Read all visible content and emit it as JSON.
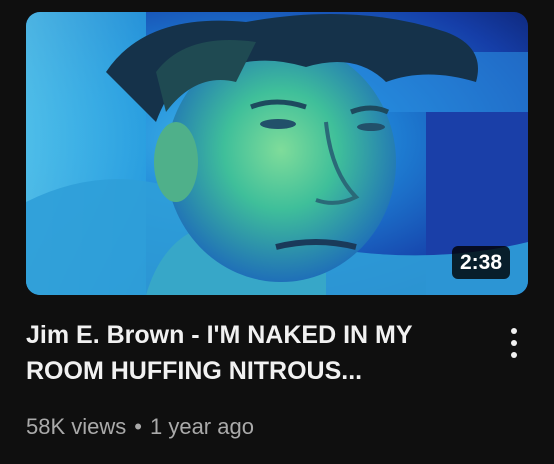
{
  "video": {
    "duration": "2:38",
    "title": "Jim E. Brown - I'M NAKED IN MY ROOM HUFFING NITROUS...",
    "views": "58K views",
    "separator": "•",
    "age": "1 year ago",
    "menu_icon": "more-vert-icon"
  },
  "colors": {
    "background": "#0f0f0f",
    "title": "#f1f1f1",
    "meta": "#aaaaaa"
  }
}
